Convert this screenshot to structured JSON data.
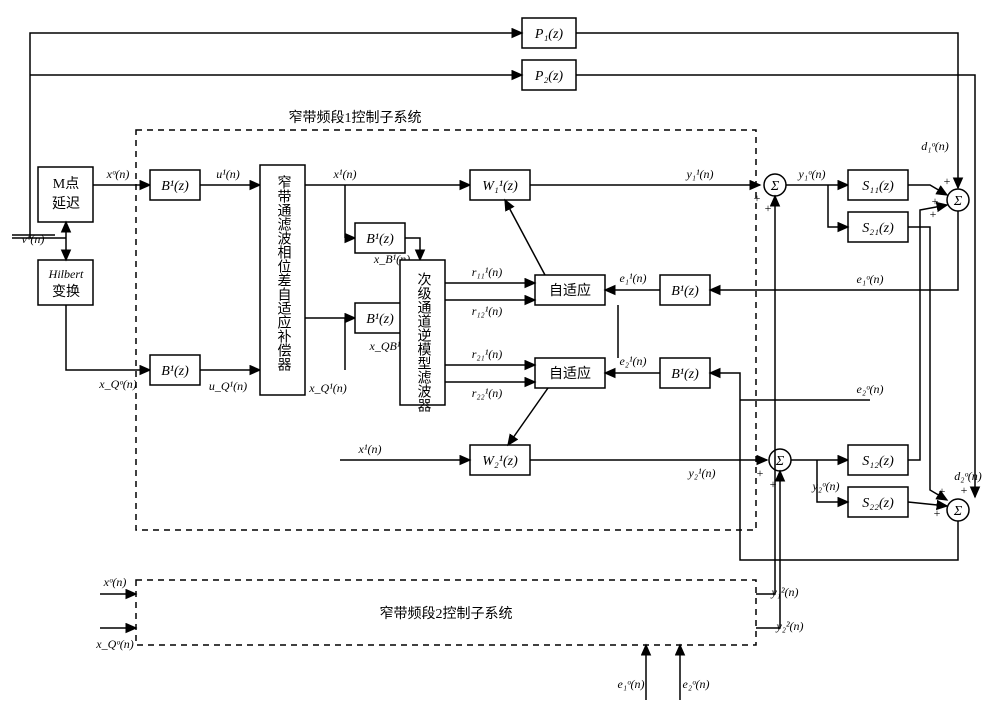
{
  "title_sub1": "窄带频段1控制子系统",
  "title_sub2": "窄带频段2控制子系统",
  "blocks": {
    "mdelay": "M点延迟",
    "hilbert": "Hilbert变换",
    "phasecomp": "窄带通滤波相位差自适应补偿器",
    "invfilter": "次级通道逆模型滤波器",
    "adapt": "自适应",
    "B1": "B¹(z)",
    "W11": "W₁¹(z)",
    "W21": "W₂¹(z)",
    "S11": "S₁₁(z)",
    "S21": "S₂₁(z)",
    "S12": "S₁₂(z)",
    "S22": "S₂₂(z)",
    "P1": "P₁(z)",
    "P2": "P₂(z)"
  },
  "signals": {
    "vo": "vᵒ(n)",
    "xo": "xᵒ(n)",
    "xQo": "x_Qᵒ(n)",
    "u1": "u¹(n)",
    "uQ1": "u_Q¹(n)",
    "x1": "x¹(n)",
    "xB1": "x_B¹(n)",
    "xQB1": "x_QB¹(n)",
    "xQ1": "x_Q¹(n)",
    "r111": "r₁₁¹(n)",
    "r121": "r₁₂¹(n)",
    "r211": "r₂₁¹(n)",
    "r221": "r₂₂¹(n)",
    "e11": "e₁¹(n)",
    "e21": "e₂¹(n)",
    "y11": "y₁¹(n)",
    "y21": "y₂¹(n)",
    "y1o": "y₁ᵒ(n)",
    "y2o": "y₂ᵒ(n)",
    "y12": "y₁²(n)",
    "y22": "y₂²(n)",
    "d1o": "d₁ᵒ(n)",
    "d2o": "d₂ᵒ(n)",
    "e1o": "e₁ᵒ(n)",
    "e2o": "e₂ᵒ(n)"
  },
  "plus": "+"
}
